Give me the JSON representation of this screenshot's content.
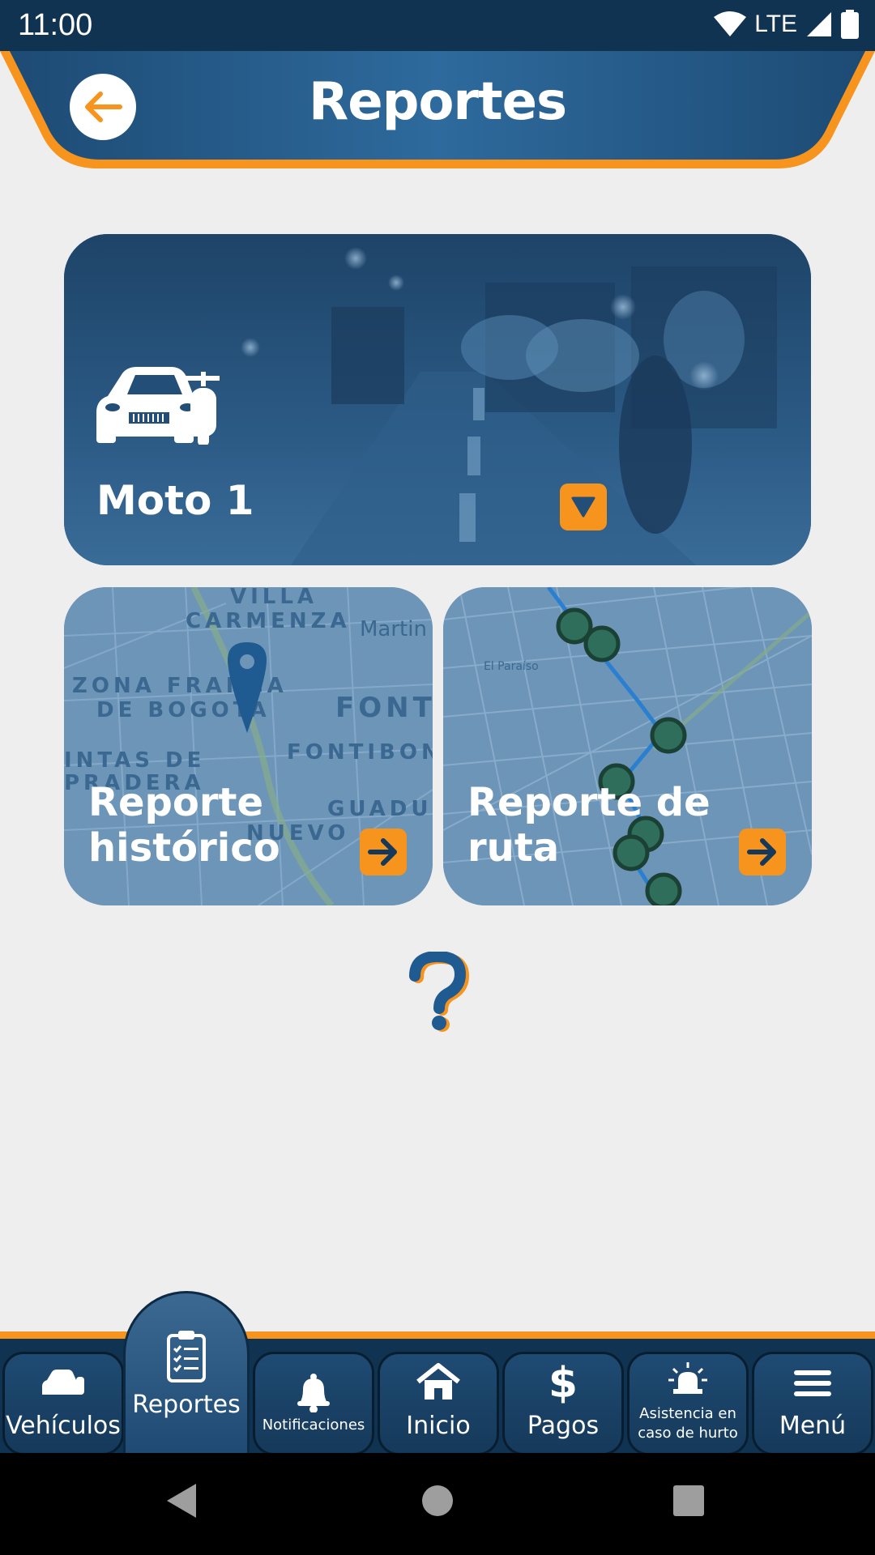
{
  "status_bar": {
    "time": "11:00",
    "network": "LTE"
  },
  "header": {
    "title": "Reportes"
  },
  "vehicle_card": {
    "name": "Moto 1"
  },
  "reports": [
    {
      "label_line1": "Reporte",
      "label_line2": "histórico"
    },
    {
      "label_line1": "Reporte de",
      "label_line2": "ruta"
    }
  ],
  "maps": {
    "historic": {
      "villa": "VILLA",
      "carmenza": "CARMENZA",
      "martin": "Martin",
      "zona_franca": "ZONA FRANCA",
      "de_bogota": "DE BOGOTA",
      "font": "FONT",
      "fontibon": "FONTIBON",
      "quintas": "INTAS DE",
      "pradera": "PRADERA",
      "guadu": "GUADU",
      "nuevo": "NUEVO"
    },
    "route": {
      "paraiso": "El Paraíso"
    }
  },
  "nav": {
    "items": [
      {
        "label": "Vehículos"
      },
      {
        "label": "Reportes"
      },
      {
        "label": "Notificaciones"
      },
      {
        "label": "Inicio"
      },
      {
        "label": "Pagos"
      },
      {
        "label_line1": "Asistencia en",
        "label_line2": "caso de hurto"
      },
      {
        "label": "Menú"
      }
    ]
  },
  "colors": {
    "primary": "#234e77",
    "accent": "#f7941d",
    "nav_bg": "#0f3351",
    "page_bg": "#eeeeee"
  },
  "icons": [
    "back-arrow-icon",
    "car-moto-icon",
    "triangle-down-icon",
    "map-pin-icon",
    "arrow-right-icon",
    "question-icon",
    "bell-icon",
    "home-icon",
    "dollar-icon",
    "alarm-icon",
    "hamburger-icon",
    "clipboard-icon"
  ]
}
